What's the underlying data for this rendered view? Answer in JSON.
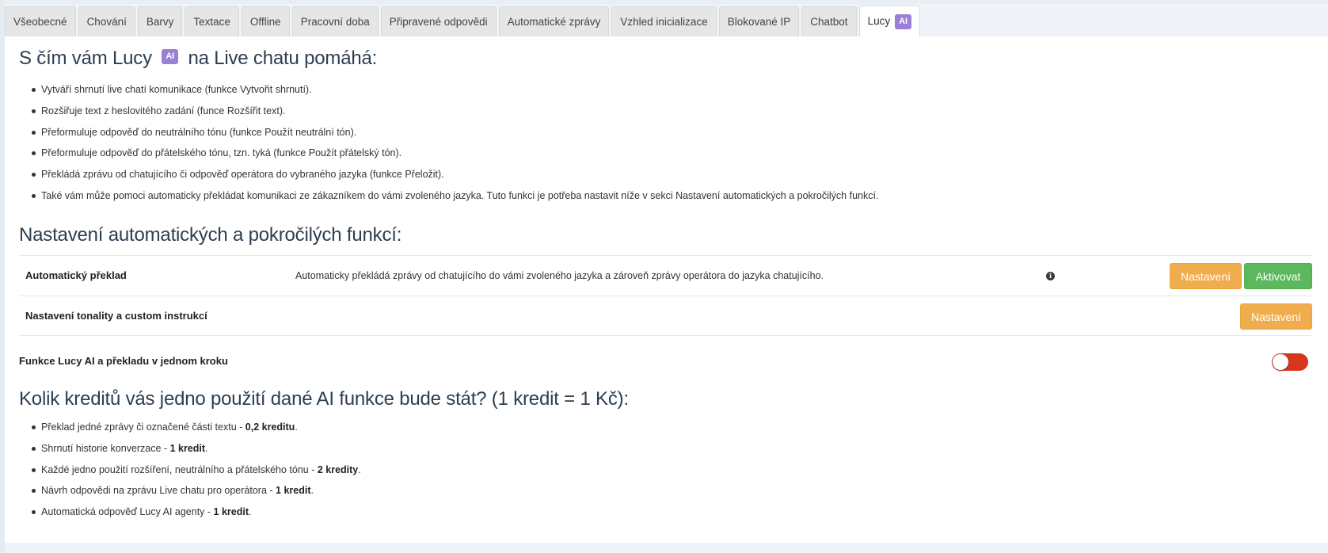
{
  "tabs": [
    {
      "label": "Všeobecné"
    },
    {
      "label": "Chování"
    },
    {
      "label": "Barvy"
    },
    {
      "label": "Textace"
    },
    {
      "label": "Offline"
    },
    {
      "label": "Pracovní doba"
    },
    {
      "label": "Připravené odpovědi"
    },
    {
      "label": "Automatické zprávy"
    },
    {
      "label": "Vzhled inicializace"
    },
    {
      "label": "Blokované IP"
    },
    {
      "label": "Chatbot"
    }
  ],
  "active_tab": {
    "label": "Lucy",
    "badge": "AI"
  },
  "intro": {
    "title_before": "S čím vám Lucy",
    "title_badge": "AI",
    "title_after": "na Live chatu pomáhá:",
    "items": [
      "Vytváří shrnutí live chatí komunikace (funkce Vytvořit shrnutí).",
      "Rozšiřuje text z heslovitého zadání (funce Rozšířit text).",
      "Přeformuluje odpověď do neutrálního tónu (funkce Použít neutrální tón).",
      "Přeformuluje odpověď do přátelského tónu, tzn. tyká (funkce Použít přátelský tón).",
      "Překládá zprávu od chatujícího či odpověď operátora do vybraného jazyka (funkce Přeložit).",
      "Také vám může pomoci automaticky překládat komunikaci ze zákazníkem do vámi zvoleného jazyka. Tuto funkci je potřeba nastavit níže v sekci Nastavení automatických a pokročilých funkcí."
    ]
  },
  "settings": {
    "title": "Nastavení automatických a pokročilých funkcí:",
    "rows": [
      {
        "label": "Automatický překlad",
        "description": "Automaticky překládá zprávy od chatujícího do vámi zvoleného jazyka a zároveň zprávy operátora do jazyka chatujícího.",
        "info_icon": "info-icon",
        "settings_button": "Nastavení",
        "activate_button": "Aktivovat"
      },
      {
        "label": "Nastavení tonality a custom instrukcí",
        "settings_button": "Nastavení"
      }
    ]
  },
  "toggle": {
    "label": "Funkce Lucy AI a překladu v jednom kroku",
    "state": "off",
    "color": "#d6361d"
  },
  "credits": {
    "title": "Kolik kreditů vás jedno použití dané AI funkce bude stát? (1 kredit = 1 Kč):",
    "items": [
      {
        "text": "Překlad jedné zprávy či označené části textu - ",
        "amount": "0,2 kreditu",
        "suffix": "."
      },
      {
        "text": "Shrnutí historie konverzace - ",
        "amount": "1 kredit",
        "suffix": "."
      },
      {
        "text": "Každé jedno použití rozšíření, neutrálního a přátelského tónu - ",
        "amount": "2 kredity",
        "suffix": "."
      },
      {
        "text": "Návrh odpovědi na zprávu Live chatu pro operátora - ",
        "amount": "1 kredit",
        "suffix": "."
      },
      {
        "text": "Automatická odpověď Lucy AI agenty - ",
        "amount": "1 kredit",
        "suffix": "."
      }
    ]
  },
  "colors": {
    "accent_ai": "#9b7fd6",
    "button_orange": "#f0ad4e",
    "button_green": "#5cb85c"
  }
}
